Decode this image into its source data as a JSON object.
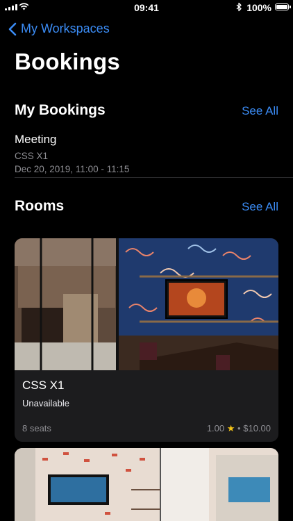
{
  "status_bar": {
    "time": "09:41",
    "battery": "100%"
  },
  "nav": {
    "back_label": "My Workspaces"
  },
  "page": {
    "title": "Bookings"
  },
  "my_bookings": {
    "header": "My Bookings",
    "see_all": "See All",
    "items": [
      {
        "title": "Meeting",
        "room": "CSS X1",
        "datetime": "Dec 20, 2019, 11:00 - 11:15"
      }
    ]
  },
  "rooms": {
    "header": "Rooms",
    "see_all": "See All",
    "items": [
      {
        "name": "CSS X1",
        "status": "Unavailable",
        "seats": "8 seats",
        "rating": "1.00",
        "price": "$10.00"
      }
    ]
  },
  "colors": {
    "accent": "#3b8cf5",
    "background": "#000000",
    "card": "#1c1c1e",
    "secondary_text": "#8e8e93"
  }
}
